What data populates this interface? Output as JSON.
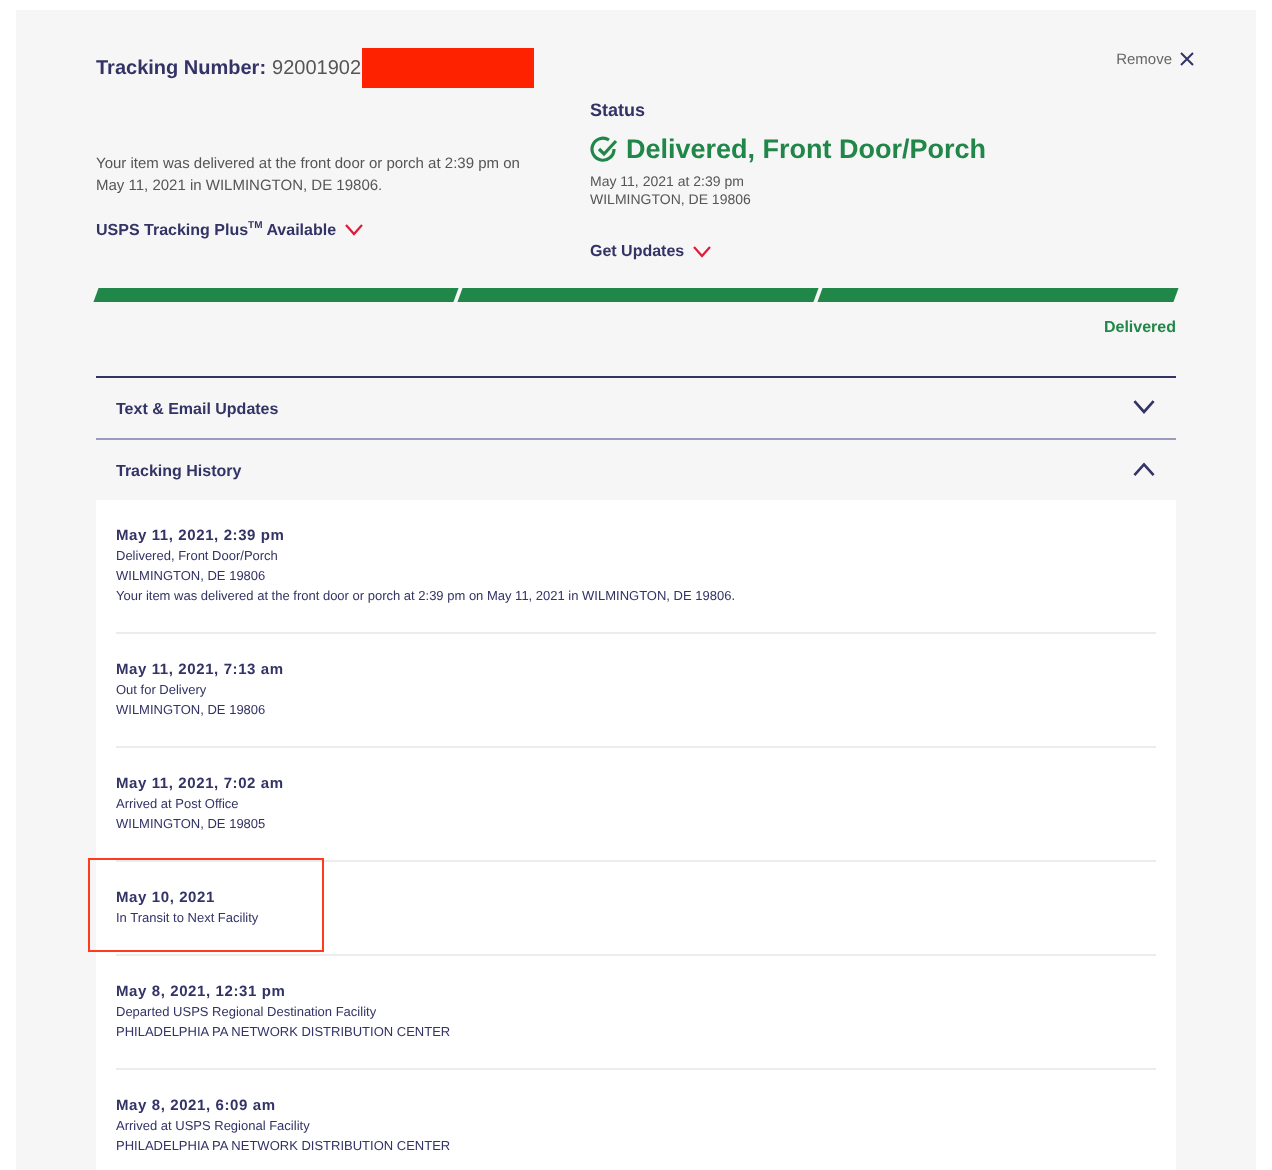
{
  "tracking": {
    "label": "Tracking Number:",
    "number": "92001902",
    "redacted": true
  },
  "remove": {
    "label": "Remove"
  },
  "summary": {
    "text": "Your item was delivered at the front door or porch at 2:39 pm on May 11, 2021 in WILMINGTON, DE 19806.",
    "link": "USPS Tracking Plus$^{TM}$ Available"
  },
  "status": {
    "heading": "Status",
    "value": "Delivered, Front Door/Porch",
    "date": "May 11, 2021 at 2:39 pm",
    "location": "WILMINGTON, DE 19806",
    "link": "Get Updates"
  },
  "progress": {
    "level": 1,
    "label": "Delivered"
  },
  "sections": [
    {
      "title": "Text & Email Updates",
      "expanded": false
    },
    {
      "title": "Tracking History",
      "expanded": true
    }
  ],
  "history": [
    {
      "date": "May 11, 2021, 2:39 pm",
      "lines": [
        "Delivered, Front Door/Porch",
        "WILMINGTON, DE 19806",
        "Your item was delivered at the front door or porch at 2:39 pm on May 11, 2021 in WILMINGTON, DE 19806."
      ],
      "highlighted": false
    },
    {
      "date": "May 11, 2021, 7:13 am",
      "lines": [
        "Out for Delivery",
        "WILMINGTON, DE 19806"
      ],
      "highlighted": false
    },
    {
      "date": "May 11, 2021, 7:02 am",
      "lines": [
        "Arrived at Post Office",
        "WILMINGTON, DE 19805"
      ],
      "highlighted": false
    },
    {
      "date": "May 10, 2021",
      "lines": [
        "In Transit to Next Facility"
      ],
      "highlighted": true
    },
    {
      "date": "May 8, 2021, 12:31 pm",
      "lines": [
        "Departed USPS Regional Destination Facility",
        "PHILADELPHIA PA NETWORK DISTRIBUTION CENTER"
      ],
      "highlighted": false
    },
    {
      "date": "May 8, 2021, 6:09 am",
      "lines": [
        "Arrived at USPS Regional Facility",
        "PHILADELPHIA PA NETWORK DISTRIBUTION CENTER"
      ],
      "highlighted": false
    }
  ]
}
